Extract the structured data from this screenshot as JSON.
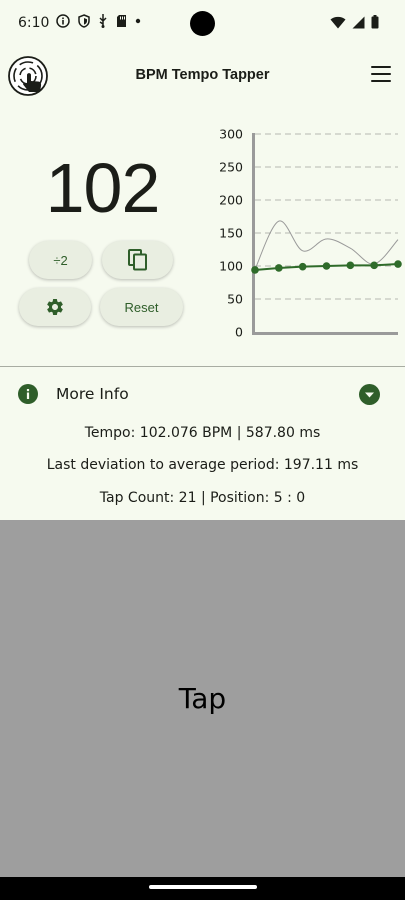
{
  "status_bar": {
    "time": "6:10"
  },
  "app_bar": {
    "title": "BPM Tempo Tapper",
    "logo_icon": "tap-hand-logo-icon",
    "menu_icon": "hamburger-menu-icon"
  },
  "tempo": {
    "bpm_display": "102"
  },
  "buttons": {
    "half_label": "÷2",
    "copy_icon": "copy-icon",
    "settings_icon": "gear-icon",
    "reset_label": "Reset"
  },
  "chart_data": {
    "type": "line",
    "yticks": [
      "300",
      "250",
      "200",
      "150",
      "100",
      "50",
      "0"
    ],
    "ylim": [
      0,
      300
    ],
    "x": [
      0,
      1,
      2,
      3,
      4,
      5,
      6
    ],
    "series": [
      {
        "values": [
          94,
          97,
          99,
          100,
          101,
          101,
          103
        ],
        "color": "#2f6b2a",
        "markers": true
      },
      {
        "values": [
          95,
          168,
          123,
          141,
          127,
          103,
          140
        ],
        "color": "#9a9a9a",
        "markers": false
      }
    ],
    "grid": "dashed-horizontal"
  },
  "info": {
    "title": "More Info",
    "tempo_line": "Tempo: 102.076 BPM | 587.80 ms",
    "deviation_line": "Last deviation to average period: 197.11 ms",
    "tap_line": "Tap Count: 21 | Position: 5  : 0"
  },
  "tap_area": {
    "label": "Tap",
    "background": "#9e9e9e"
  },
  "colors": {
    "background": "#f6faef",
    "accent": "#2f5e2a",
    "pill": "#e9eee1"
  }
}
